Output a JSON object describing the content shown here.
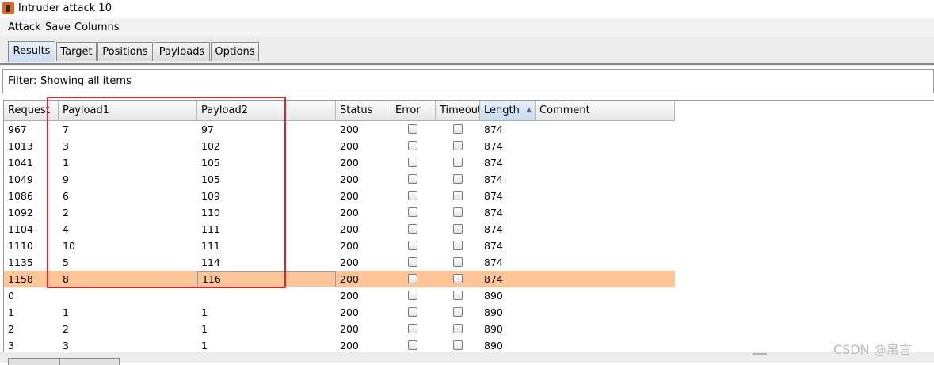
{
  "window": {
    "title": "Intruder attack 10"
  },
  "menu": [
    "Attack",
    "Save",
    "Columns"
  ],
  "tabs": [
    {
      "label": "Results",
      "active": true
    },
    {
      "label": "Target",
      "active": false
    },
    {
      "label": "Positions",
      "active": false
    },
    {
      "label": "Payloads",
      "active": false
    },
    {
      "label": "Options",
      "active": false
    }
  ],
  "filter": {
    "label": "Filter:",
    "text": "Showing all items"
  },
  "table": {
    "columns": [
      "Request",
      "Payload1",
      "Payload2",
      "Status",
      "Error",
      "Timeout",
      "Length",
      "Comment"
    ],
    "sorted_column": "Length",
    "sort_direction": "ascending",
    "rows": [
      {
        "request": "967",
        "payload1": "7",
        "payload2": "97",
        "status": "200",
        "error": false,
        "timeout": false,
        "length": "874",
        "comment": ""
      },
      {
        "request": "1013",
        "payload1": "3",
        "payload2": "102",
        "status": "200",
        "error": false,
        "timeout": false,
        "length": "874",
        "comment": ""
      },
      {
        "request": "1041",
        "payload1": "1",
        "payload2": "105",
        "status": "200",
        "error": false,
        "timeout": false,
        "length": "874",
        "comment": ""
      },
      {
        "request": "1049",
        "payload1": "9",
        "payload2": "105",
        "status": "200",
        "error": false,
        "timeout": false,
        "length": "874",
        "comment": ""
      },
      {
        "request": "1086",
        "payload1": "6",
        "payload2": "109",
        "status": "200",
        "error": false,
        "timeout": false,
        "length": "874",
        "comment": ""
      },
      {
        "request": "1092",
        "payload1": "2",
        "payload2": "110",
        "status": "200",
        "error": false,
        "timeout": false,
        "length": "874",
        "comment": ""
      },
      {
        "request": "1104",
        "payload1": "4",
        "payload2": "111",
        "status": "200",
        "error": false,
        "timeout": false,
        "length": "874",
        "comment": ""
      },
      {
        "request": "1110",
        "payload1": "10",
        "payload2": "111",
        "status": "200",
        "error": false,
        "timeout": false,
        "length": "874",
        "comment": ""
      },
      {
        "request": "1135",
        "payload1": "5",
        "payload2": "114",
        "status": "200",
        "error": false,
        "timeout": false,
        "length": "874",
        "comment": ""
      },
      {
        "request": "1158",
        "payload1": "8",
        "payload2": "116",
        "status": "200",
        "error": false,
        "timeout": false,
        "length": "874",
        "comment": "",
        "selected": true
      },
      {
        "request": "0",
        "payload1": "",
        "payload2": "",
        "status": "200",
        "error": false,
        "timeout": false,
        "length": "890",
        "comment": ""
      },
      {
        "request": "1",
        "payload1": "1",
        "payload2": "1",
        "status": "200",
        "error": false,
        "timeout": false,
        "length": "890",
        "comment": ""
      },
      {
        "request": "2",
        "payload1": "2",
        "payload2": "1",
        "status": "200",
        "error": false,
        "timeout": false,
        "length": "890",
        "comment": ""
      },
      {
        "request": "3",
        "payload1": "3",
        "payload2": "1",
        "status": "200",
        "error": false,
        "timeout": false,
        "length": "890",
        "comment": ""
      }
    ]
  },
  "colors": {
    "selected_row": "#ffc596",
    "highlight_box": "#e0222a",
    "sorted_header": "#c9dbee"
  },
  "watermark": "CSDN @帛言"
}
